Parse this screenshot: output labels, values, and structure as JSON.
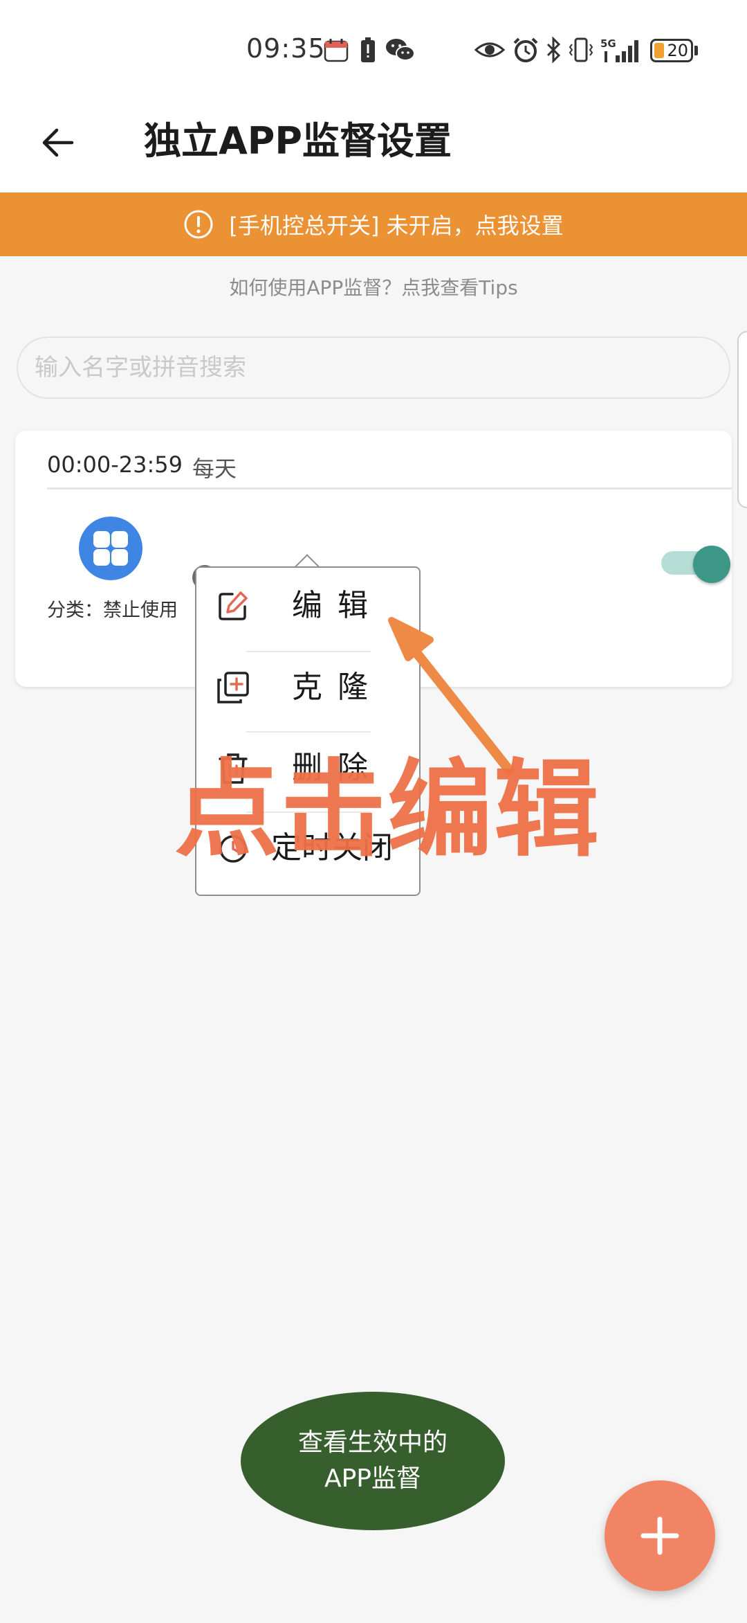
{
  "status_bar": {
    "time": "09:35",
    "battery_level": "20",
    "network_label": "5G",
    "icons": [
      "calendar-icon",
      "battery-alert-icon",
      "wechat-icon",
      "eye-icon",
      "alarm-icon",
      "bluetooth-icon",
      "vibrate-icon",
      "signal-icon",
      "battery-icon"
    ]
  },
  "header": {
    "title": "独立APP监督设置",
    "back_icon": "arrow-left-icon"
  },
  "warning_banner": {
    "text": "[手机控总开关] 未开启，点我设置",
    "icon": "alert-circle-icon",
    "color": "#eb9235"
  },
  "tips_link": "如何使用APP监督？点我查看Tips",
  "search": {
    "placeholder": "输入名字或拼音搜索",
    "value": ""
  },
  "rule_card": {
    "time_range": "00:00-23:59",
    "repeat": "每天",
    "app_label": "分类：禁止使用",
    "toggle_on": true,
    "toggle_color": "#3d9787"
  },
  "popup_menu": {
    "items": [
      {
        "label": "编辑",
        "icon": "edit-icon"
      },
      {
        "label": "克隆",
        "icon": "clone-icon"
      },
      {
        "label": "删除",
        "icon": "trash-icon"
      },
      {
        "label": "定时关闭",
        "icon": "timer-icon"
      }
    ]
  },
  "annotation": {
    "text": "点击编辑",
    "color": "#ee7148"
  },
  "bottom": {
    "active_button": {
      "line1": "查看生效中的",
      "line2": "APP监督"
    },
    "fab_icon": "plus-icon",
    "fab_color": "#f28466"
  }
}
